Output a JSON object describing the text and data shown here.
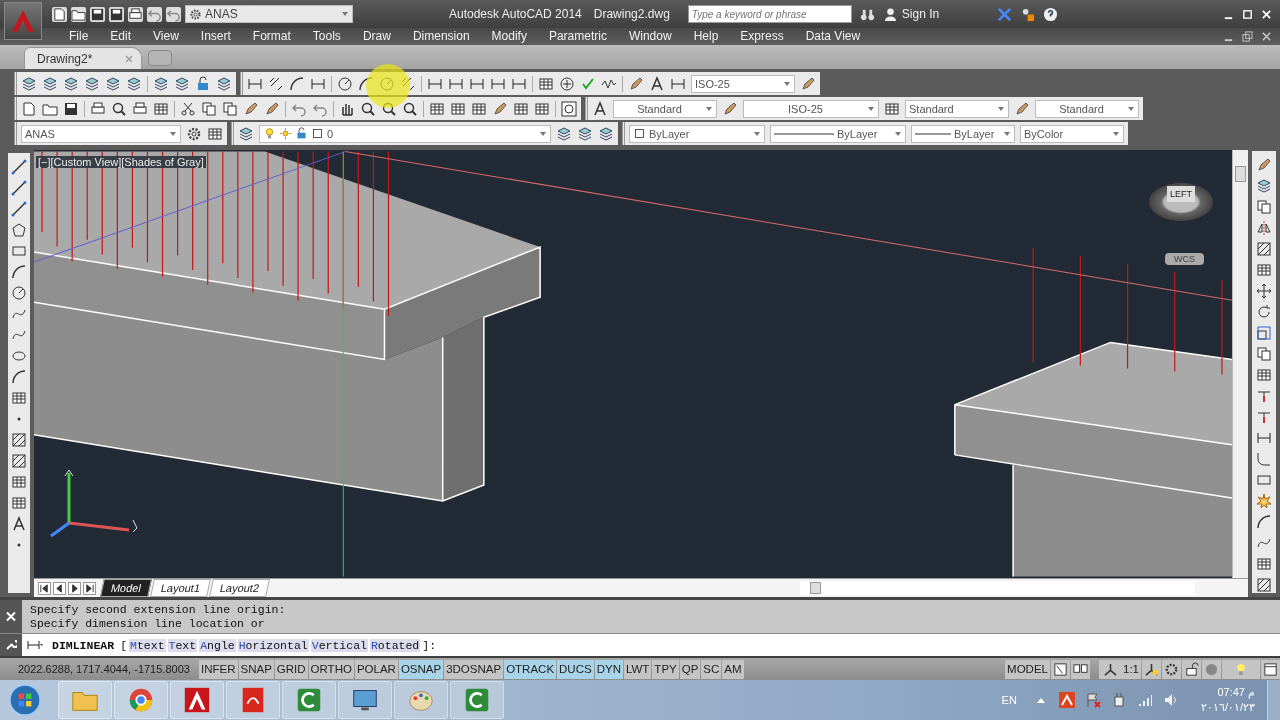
{
  "title_bar": {
    "workspace": "ANAS",
    "app_title": "Autodesk AutoCAD 2014",
    "file_name": "Drawing2.dwg",
    "search": {
      "placeholder": "Type a keyword or phrase"
    },
    "sign_in": "Sign In"
  },
  "menu": [
    "File",
    "Edit",
    "View",
    "Insert",
    "Format",
    "Tools",
    "Draw",
    "Dimension",
    "Modify",
    "Parametric",
    "Window",
    "Help",
    "Express",
    "Data View"
  ],
  "document_tabs": [
    {
      "label": "Drawing2*",
      "selected": true
    }
  ],
  "toolbars": {
    "dimension_style": "ISO-25",
    "text_style": "Standard",
    "dimension_style_2": "ISO-25",
    "table_style": "Standard",
    "multileader_style": "Standard",
    "workspace": "ANAS",
    "layer": "0",
    "object_color": "ByLayer",
    "linetype": "ByLayer",
    "lineweight": "ByLayer",
    "plot_style": "ByColor"
  },
  "viewport": {
    "label": "[−][Custom View][Shades of Gray]",
    "viewcube_face": "LEFT",
    "coordinate_system": "WCS"
  },
  "layout_tabs": [
    {
      "label": "Model",
      "selected": true
    },
    {
      "label": "Layout1",
      "selected": false
    },
    {
      "label": "Layout2",
      "selected": false
    }
  ],
  "command_history": [
    "Specify second extension line origin:",
    "Specify dimension line location or"
  ],
  "command_line": {
    "command": "DIMLINEAR",
    "open": "[",
    "close": "]:",
    "options": [
      {
        "key": "M",
        "rest": "text"
      },
      {
        "key": "T",
        "rest": "ext"
      },
      {
        "key": "A",
        "rest": "ngle"
      },
      {
        "key": "H",
        "rest": "orizontal"
      },
      {
        "key": "V",
        "rest": "ertical"
      },
      {
        "key": "R",
        "rest": "otated"
      }
    ]
  },
  "status_bar": {
    "coordinates": "2022.6288, 1717.4044, -1715.8003",
    "toggles": [
      {
        "label": "INFER",
        "on": false
      },
      {
        "label": "SNAP",
        "on": false
      },
      {
        "label": "GRID",
        "on": false
      },
      {
        "label": "ORTHO",
        "on": false
      },
      {
        "label": "POLAR",
        "on": false
      },
      {
        "label": "OSNAP",
        "on": true
      },
      {
        "label": "3DOSNAP",
        "on": false
      },
      {
        "label": "OTRACK",
        "on": true
      },
      {
        "label": "DUCS",
        "on": true
      },
      {
        "label": "DYN",
        "on": true
      },
      {
        "label": "LWT",
        "on": false
      },
      {
        "label": "TPY",
        "on": false
      },
      {
        "label": "QP",
        "on": false
      },
      {
        "label": "SC",
        "on": false
      },
      {
        "label": "AM",
        "on": false
      }
    ],
    "space": "MODEL",
    "annotation_scale": "1:1"
  },
  "taskbar": {
    "language": "EN",
    "time": "07:47 م",
    "date": "٢٠١٦/٠١/٢٣"
  }
}
